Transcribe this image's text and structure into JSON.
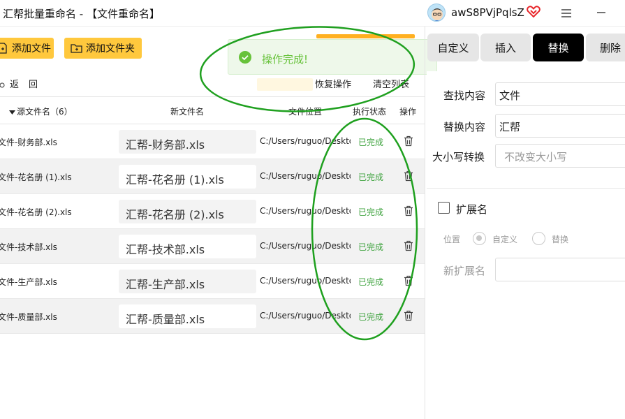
{
  "window": {
    "title": "汇帮批量重命名 - 【文件重命名】",
    "username": "awS8PVjPqlsZ"
  },
  "toolbar": {
    "add_files": "添加文件",
    "add_folder": "添加文件夹"
  },
  "toast": {
    "message": "操作完成!"
  },
  "actions": {
    "back": [
      "返",
      "回"
    ],
    "restore": "恢复操作",
    "clear_list": "清空列表"
  },
  "table": {
    "headers": {
      "source": "源文件名（6）",
      "new_name": "新文件名",
      "location": "文件位置",
      "status": "执行状态",
      "operation": "操作"
    },
    "rows": [
      {
        "source": "文件-财务部.xls",
        "new_name": "汇帮-财务部.xls",
        "location": "C:/Users/ruguo/Desktop",
        "status": "已完成"
      },
      {
        "source": "文件-花名册 (1).xls",
        "new_name": "汇帮-花名册 (1).xls",
        "location": "C:/Users/ruguo/Desktop",
        "status": "已完成"
      },
      {
        "source": "文件-花名册 (2).xls",
        "new_name": "汇帮-花名册 (2).xls",
        "location": "C:/Users/ruguo/Desktop",
        "status": "已完成"
      },
      {
        "source": "文件-技术部.xls",
        "new_name": "汇帮-技术部.xls",
        "location": "C:/Users/ruguo/Desktop",
        "status": "已完成"
      },
      {
        "source": "文件-生产部.xls",
        "new_name": "汇帮-生产部.xls",
        "location": "C:/Users/ruguo/Desktop",
        "status": "已完成"
      },
      {
        "source": "文件-质量部.xls",
        "new_name": "汇帮-质量部.xls",
        "location": "C:/Users/ruguo/Desktop",
        "status": "已完成"
      }
    ]
  },
  "tabs": [
    "自定义",
    "插入",
    "替换",
    "删除"
  ],
  "active_tab": "替换",
  "replace_panel": {
    "find_label": "查找内容",
    "find_value": "文件",
    "replace_label": "替换内容",
    "replace_value": "汇帮",
    "case_label": "大小写转换",
    "case_value": "不改变大小写",
    "extension_label": "扩展名",
    "position_label": "位置",
    "position_options": [
      "自定义",
      "替换"
    ],
    "new_ext_label": "新扩展名",
    "new_ext_value": ""
  },
  "colors": {
    "accent": "#ffc83d",
    "success": "#3fa33f",
    "toast_bg": "#eef8ea",
    "annotation": "#1fa01f"
  }
}
